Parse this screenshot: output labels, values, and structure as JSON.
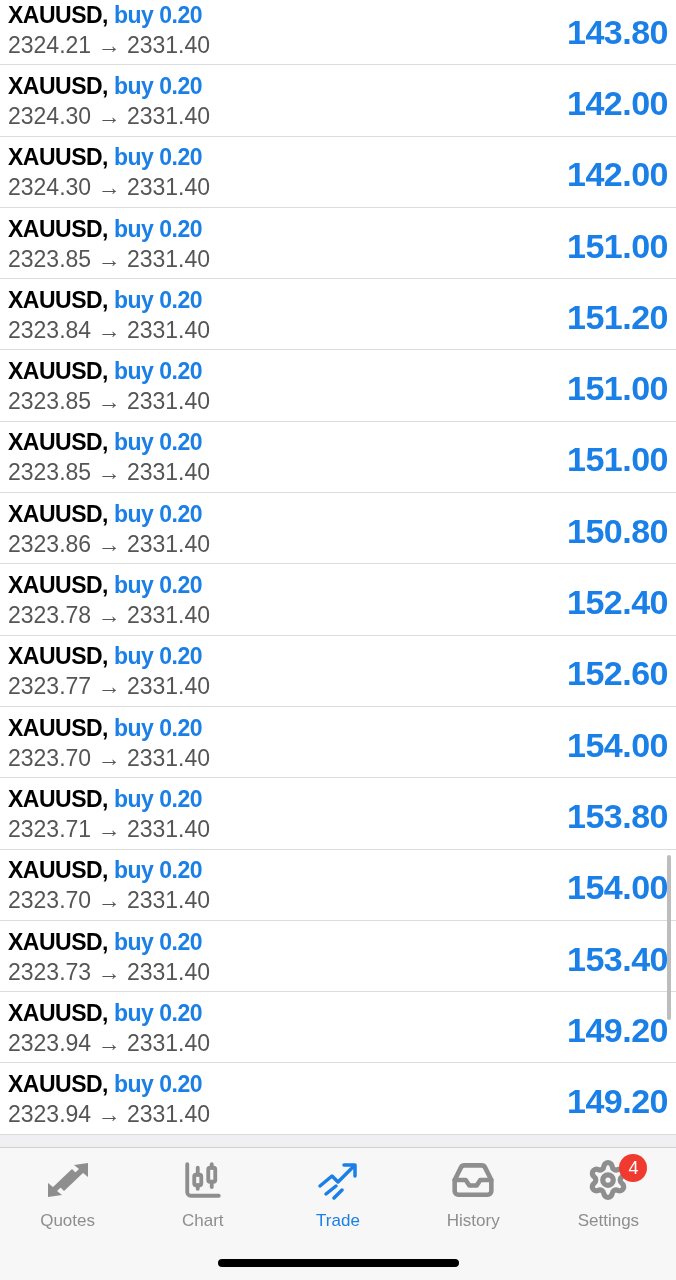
{
  "positions": [
    {
      "symbol": "XAUUSD,",
      "order": "buy 0.20",
      "prices": "2324.21 → 2331.40",
      "profit": "143.80"
    },
    {
      "symbol": "XAUUSD,",
      "order": "buy 0.20",
      "prices": "2324.30 → 2331.40",
      "profit": "142.00"
    },
    {
      "symbol": "XAUUSD,",
      "order": "buy 0.20",
      "prices": "2324.30 → 2331.40",
      "profit": "142.00"
    },
    {
      "symbol": "XAUUSD,",
      "order": "buy 0.20",
      "prices": "2323.85 → 2331.40",
      "profit": "151.00"
    },
    {
      "symbol": "XAUUSD,",
      "order": "buy 0.20",
      "prices": "2323.84 → 2331.40",
      "profit": "151.20"
    },
    {
      "symbol": "XAUUSD,",
      "order": "buy 0.20",
      "prices": "2323.85 → 2331.40",
      "profit": "151.00"
    },
    {
      "symbol": "XAUUSD,",
      "order": "buy 0.20",
      "prices": "2323.85 → 2331.40",
      "profit": "151.00"
    },
    {
      "symbol": "XAUUSD,",
      "order": "buy 0.20",
      "prices": "2323.86 → 2331.40",
      "profit": "150.80"
    },
    {
      "symbol": "XAUUSD,",
      "order": "buy 0.20",
      "prices": "2323.78 → 2331.40",
      "profit": "152.40"
    },
    {
      "symbol": "XAUUSD,",
      "order": "buy 0.20",
      "prices": "2323.77 → 2331.40",
      "profit": "152.60"
    },
    {
      "symbol": "XAUUSD,",
      "order": "buy 0.20",
      "prices": "2323.70 → 2331.40",
      "profit": "154.00"
    },
    {
      "symbol": "XAUUSD,",
      "order": "buy 0.20",
      "prices": "2323.71 → 2331.40",
      "profit": "153.80"
    },
    {
      "symbol": "XAUUSD,",
      "order": "buy 0.20",
      "prices": "2323.70 → 2331.40",
      "profit": "154.00"
    },
    {
      "symbol": "XAUUSD,",
      "order": "buy 0.20",
      "prices": "2323.73 → 2331.40",
      "profit": "153.40"
    },
    {
      "symbol": "XAUUSD,",
      "order": "buy 0.20",
      "prices": "2323.94 → 2331.40",
      "profit": "149.20"
    },
    {
      "symbol": "XAUUSD,",
      "order": "buy 0.20",
      "prices": "2323.94 → 2331.40",
      "profit": "149.20"
    }
  ],
  "tab_bar": [
    {
      "kind": "quotes",
      "label": "Quotes",
      "selected": false
    },
    {
      "kind": "chart",
      "label": "Chart",
      "selected": false
    },
    {
      "kind": "trade",
      "label": "Trade",
      "selected": true
    },
    {
      "kind": "history",
      "label": "History",
      "selected": false
    },
    {
      "kind": "settings",
      "label": "Settings",
      "selected": false,
      "badge": "4"
    }
  ]
}
